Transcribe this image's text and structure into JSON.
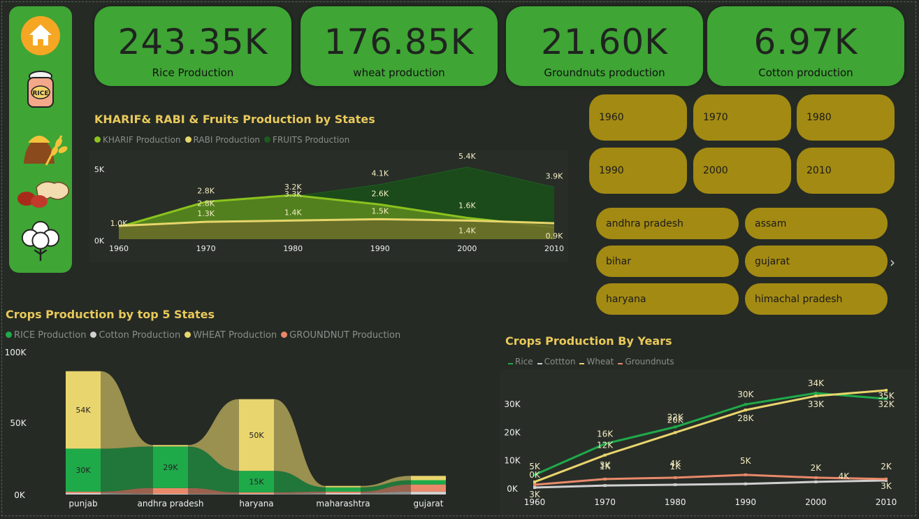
{
  "sidebar": {
    "items": [
      {
        "name": "home-icon"
      },
      {
        "name": "rice-bag-icon"
      },
      {
        "name": "wheat-icon"
      },
      {
        "name": "groundnut-icon"
      },
      {
        "name": "cotton-icon"
      }
    ],
    "rice_label": "RICE"
  },
  "kpis": [
    {
      "value": "243.35K",
      "label": "Rice Production"
    },
    {
      "value": "176.85K",
      "label": "wheat production"
    },
    {
      "value": "21.60K",
      "label": "Groundnuts production"
    },
    {
      "value": "6.97K",
      "label": "Cotton production"
    }
  ],
  "years": [
    "1960",
    "1970",
    "1980",
    "1990",
    "2000",
    "2010"
  ],
  "states": [
    "andhra pradesh",
    "assam",
    "bihar",
    "gujarat",
    "haryana",
    "himachal pradesh"
  ],
  "colors": {
    "accent_green": "#3fa535",
    "slicer_gold": "#a38a12",
    "title_gold": "#e8c95a",
    "kharif": "#8cc21e",
    "rabi": "#e6d66a",
    "fruits": "#1e5a1e",
    "rice": "#1faa4a",
    "cotton": "#d0d0d0",
    "wheat": "#e9d56d",
    "groundnut": "#e9896a"
  },
  "chart_data": [
    {
      "type": "area",
      "title": "KHARIF& RABI & Fruits Production by States",
      "legend": [
        "KHARIF Production",
        "RABI Production",
        "FRUITS Production"
      ],
      "x": [
        "1960",
        "1970",
        "1980",
        "1990",
        "2000",
        "2010"
      ],
      "y_ticks": [
        "0K",
        "5K"
      ],
      "series": [
        {
          "name": "KHARIF Production",
          "values": [
            0.9,
            2.8,
            3.3,
            2.6,
            1.6,
            0.9
          ],
          "labels": [
            "",
            "2.8K",
            "3.3K",
            "2.6K",
            "1.6K",
            "0.9K"
          ]
        },
        {
          "name": "RABI Production",
          "values": [
            1.0,
            1.3,
            1.4,
            1.5,
            1.4,
            1.2
          ],
          "labels": [
            "1.0K",
            "1.3K",
            "1.4K",
            "1.5K",
            "1.4K",
            ""
          ]
        },
        {
          "name": "FRUITS Production",
          "values": [
            1.0,
            2.8,
            3.2,
            4.1,
            5.4,
            3.9
          ],
          "labels": [
            "",
            "2.8K",
            "3.2K",
            "4.1K",
            "5.4K",
            "3.9K"
          ]
        }
      ]
    },
    {
      "type": "bar",
      "title": "Crops Production by top 5 States",
      "legend": [
        "RICE Production",
        "Cotton Production",
        "WHEAT Production",
        "GROUNDNUT Production"
      ],
      "categories": [
        "punjab",
        "andhra pradesh",
        "haryana",
        "maharashtra",
        "gujarat"
      ],
      "y_ticks": [
        "0K",
        "50K",
        "100K"
      ],
      "series": [
        {
          "name": "RICE Production",
          "values": [
            30,
            29,
            15,
            3,
            3
          ],
          "labels": [
            "30K",
            "29K",
            "15K",
            "",
            ""
          ]
        },
        {
          "name": "Cotton Production",
          "values": [
            1,
            0.5,
            0.5,
            1,
            2
          ],
          "labels": [
            "",
            "",
            "",
            "",
            ""
          ]
        },
        {
          "name": "WHEAT Production",
          "values": [
            54,
            1,
            50,
            1,
            3
          ],
          "labels": [
            "54K",
            "",
            "50K",
            "",
            ""
          ]
        },
        {
          "name": "GROUNDNUT Production",
          "values": [
            1,
            4,
            1,
            1,
            5
          ],
          "labels": [
            "",
            "",
            "",
            "",
            ""
          ]
        }
      ]
    },
    {
      "type": "line",
      "title": "Crops Production By Years",
      "legend": [
        "Rice",
        "Cottton",
        "Wheat",
        "Groundnuts"
      ],
      "x": [
        "1960",
        "1970",
        "1980",
        "1990",
        "2000",
        "2010"
      ],
      "y_ticks": [
        "0K",
        "10K",
        "20K",
        "30K"
      ],
      "series": [
        {
          "name": "Rice",
          "values": [
            5,
            16,
            22,
            30,
            34,
            32
          ],
          "labels": [
            "5K",
            "16K",
            "22K",
            "30K",
            "34K",
            "32K"
          ]
        },
        {
          "name": "Cottton",
          "values": [
            0.5,
            1.2,
            1.5,
            1.8,
            2.5,
            3
          ],
          "labels": [
            "",
            "",
            "",
            "",
            "",
            "3K"
          ]
        },
        {
          "name": "Wheat",
          "values": [
            2.5,
            12,
            20,
            28,
            33,
            35
          ],
          "labels": [
            "0K",
            "12K",
            "20K",
            "28K",
            "33K",
            "35K"
          ]
        },
        {
          "name": "Groundnuts",
          "values": [
            1.5,
            3.5,
            4,
            5,
            4,
            3.5
          ],
          "labels": [
            "3K",
            "3K",
            "4K",
            "5K",
            "2K",
            "2K"
          ]
        }
      ],
      "extra_labels": [
        "1K",
        "1K",
        "4K"
      ]
    }
  ]
}
